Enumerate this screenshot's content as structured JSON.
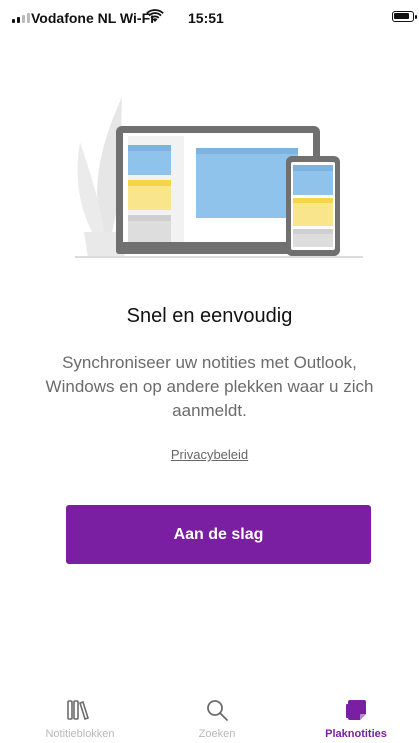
{
  "status_bar": {
    "carrier": "Vodafone NL Wi-Fi",
    "time": "15:51",
    "icons": [
      "signal-icon",
      "wifi-icon",
      "battery-icon"
    ]
  },
  "onboarding": {
    "title": "Snel en eenvoudig",
    "description": "Synchroniseer uw notities met Outlook, Windows en op andere plekken waar u zich aanmeldt.",
    "privacy_link": "Privacybeleid",
    "start_button": "Aan de slag"
  },
  "tab_bar": {
    "tabs": [
      {
        "label": "Notitieblokken",
        "icon": "notebooks-icon",
        "active": false
      },
      {
        "label": "Zoeken",
        "icon": "search-icon",
        "active": false
      },
      {
        "label": "Plaknotities",
        "icon": "sticky-notes-icon",
        "active": true
      }
    ]
  },
  "colors": {
    "accent": "#7a1fa2",
    "text_secondary": "#6b6b6b",
    "tab_inactive": "#b8b8b8",
    "illustration_blue": "#8fc3ec",
    "illustration_yellow": "#f8e58c"
  }
}
